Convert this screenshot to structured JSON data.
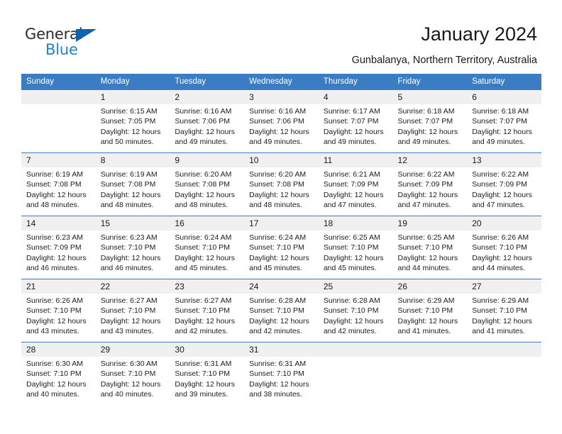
{
  "brand": {
    "word_one": "General",
    "word_two": "Blue",
    "triangle_icon": "triangle-icon",
    "color_dark": "#2b2b2b",
    "color_blue": "#1b84d0"
  },
  "header": {
    "title": "January 2024",
    "subtitle": "Gunbalanya, Northern Territory, Australia"
  },
  "theme": {
    "header_blue": "#3b7dc4",
    "daynum_band": "#f0f0f0",
    "text": "#1a1a1a"
  },
  "weekday_headers": [
    "Sunday",
    "Monday",
    "Tuesday",
    "Wednesday",
    "Thursday",
    "Friday",
    "Saturday"
  ],
  "weeks": [
    [
      {
        "day": "",
        "info": ""
      },
      {
        "day": "1",
        "info": "Sunrise: 6:15 AM\nSunset: 7:05 PM\nDaylight: 12 hours and 50 minutes."
      },
      {
        "day": "2",
        "info": "Sunrise: 6:16 AM\nSunset: 7:06 PM\nDaylight: 12 hours and 49 minutes."
      },
      {
        "day": "3",
        "info": "Sunrise: 6:16 AM\nSunset: 7:06 PM\nDaylight: 12 hours and 49 minutes."
      },
      {
        "day": "4",
        "info": "Sunrise: 6:17 AM\nSunset: 7:07 PM\nDaylight: 12 hours and 49 minutes."
      },
      {
        "day": "5",
        "info": "Sunrise: 6:18 AM\nSunset: 7:07 PM\nDaylight: 12 hours and 49 minutes."
      },
      {
        "day": "6",
        "info": "Sunrise: 6:18 AM\nSunset: 7:07 PM\nDaylight: 12 hours and 49 minutes."
      }
    ],
    [
      {
        "day": "7",
        "info": "Sunrise: 6:19 AM\nSunset: 7:08 PM\nDaylight: 12 hours and 48 minutes."
      },
      {
        "day": "8",
        "info": "Sunrise: 6:19 AM\nSunset: 7:08 PM\nDaylight: 12 hours and 48 minutes."
      },
      {
        "day": "9",
        "info": "Sunrise: 6:20 AM\nSunset: 7:08 PM\nDaylight: 12 hours and 48 minutes."
      },
      {
        "day": "10",
        "info": "Sunrise: 6:20 AM\nSunset: 7:08 PM\nDaylight: 12 hours and 48 minutes."
      },
      {
        "day": "11",
        "info": "Sunrise: 6:21 AM\nSunset: 7:09 PM\nDaylight: 12 hours and 47 minutes."
      },
      {
        "day": "12",
        "info": "Sunrise: 6:22 AM\nSunset: 7:09 PM\nDaylight: 12 hours and 47 minutes."
      },
      {
        "day": "13",
        "info": "Sunrise: 6:22 AM\nSunset: 7:09 PM\nDaylight: 12 hours and 47 minutes."
      }
    ],
    [
      {
        "day": "14",
        "info": "Sunrise: 6:23 AM\nSunset: 7:09 PM\nDaylight: 12 hours and 46 minutes."
      },
      {
        "day": "15",
        "info": "Sunrise: 6:23 AM\nSunset: 7:10 PM\nDaylight: 12 hours and 46 minutes."
      },
      {
        "day": "16",
        "info": "Sunrise: 6:24 AM\nSunset: 7:10 PM\nDaylight: 12 hours and 45 minutes."
      },
      {
        "day": "17",
        "info": "Sunrise: 6:24 AM\nSunset: 7:10 PM\nDaylight: 12 hours and 45 minutes."
      },
      {
        "day": "18",
        "info": "Sunrise: 6:25 AM\nSunset: 7:10 PM\nDaylight: 12 hours and 45 minutes."
      },
      {
        "day": "19",
        "info": "Sunrise: 6:25 AM\nSunset: 7:10 PM\nDaylight: 12 hours and 44 minutes."
      },
      {
        "day": "20",
        "info": "Sunrise: 6:26 AM\nSunset: 7:10 PM\nDaylight: 12 hours and 44 minutes."
      }
    ],
    [
      {
        "day": "21",
        "info": "Sunrise: 6:26 AM\nSunset: 7:10 PM\nDaylight: 12 hours and 43 minutes."
      },
      {
        "day": "22",
        "info": "Sunrise: 6:27 AM\nSunset: 7:10 PM\nDaylight: 12 hours and 43 minutes."
      },
      {
        "day": "23",
        "info": "Sunrise: 6:27 AM\nSunset: 7:10 PM\nDaylight: 12 hours and 42 minutes."
      },
      {
        "day": "24",
        "info": "Sunrise: 6:28 AM\nSunset: 7:10 PM\nDaylight: 12 hours and 42 minutes."
      },
      {
        "day": "25",
        "info": "Sunrise: 6:28 AM\nSunset: 7:10 PM\nDaylight: 12 hours and 42 minutes."
      },
      {
        "day": "26",
        "info": "Sunrise: 6:29 AM\nSunset: 7:10 PM\nDaylight: 12 hours and 41 minutes."
      },
      {
        "day": "27",
        "info": "Sunrise: 6:29 AM\nSunset: 7:10 PM\nDaylight: 12 hours and 41 minutes."
      }
    ],
    [
      {
        "day": "28",
        "info": "Sunrise: 6:30 AM\nSunset: 7:10 PM\nDaylight: 12 hours and 40 minutes."
      },
      {
        "day": "29",
        "info": "Sunrise: 6:30 AM\nSunset: 7:10 PM\nDaylight: 12 hours and 40 minutes."
      },
      {
        "day": "30",
        "info": "Sunrise: 6:31 AM\nSunset: 7:10 PM\nDaylight: 12 hours and 39 minutes."
      },
      {
        "day": "31",
        "info": "Sunrise: 6:31 AM\nSunset: 7:10 PM\nDaylight: 12 hours and 38 minutes."
      },
      {
        "day": "",
        "info": ""
      },
      {
        "day": "",
        "info": ""
      },
      {
        "day": "",
        "info": ""
      }
    ]
  ]
}
